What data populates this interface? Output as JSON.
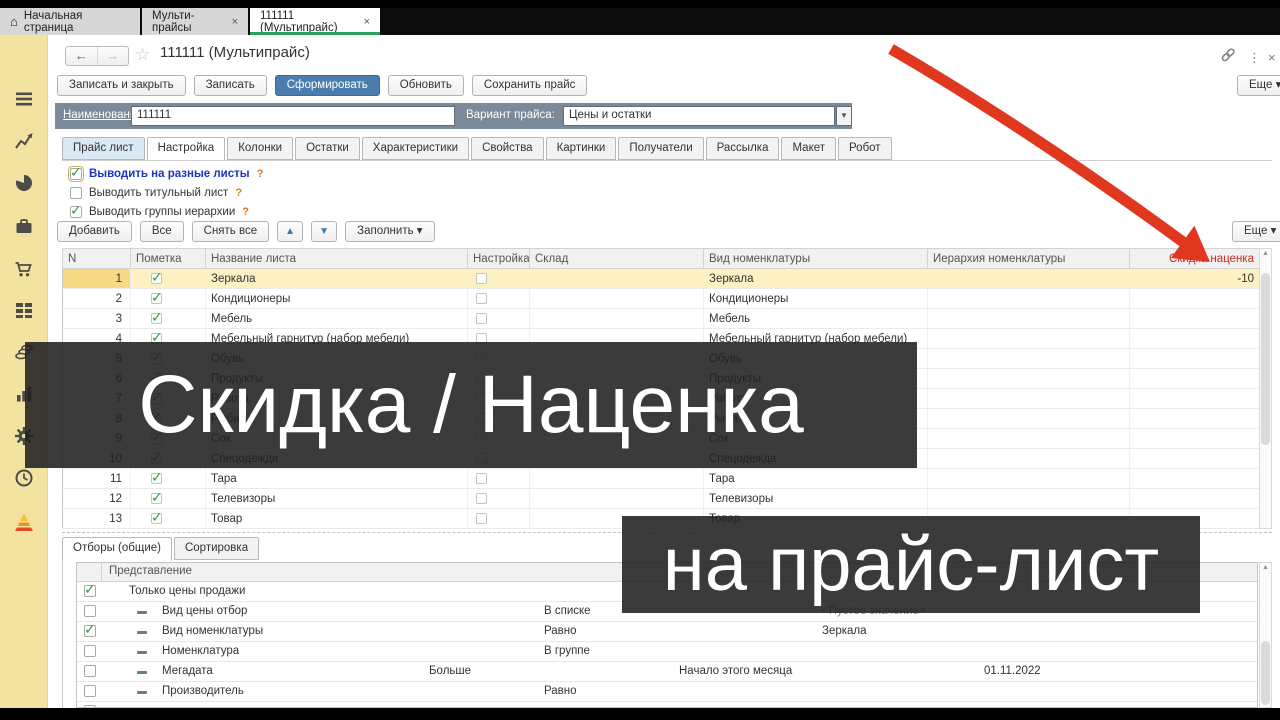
{
  "window_tabs": [
    {
      "label": "Начальная страница",
      "close": "",
      "active": false
    },
    {
      "label": "Мульти-прайсы",
      "close": "×",
      "active": false
    },
    {
      "label": "111111 (Мультипрайс)",
      "close": "×",
      "active": true
    }
  ],
  "titlebar": {
    "back": "←",
    "forward": "→",
    "star": "☆",
    "title": "111111 (Мультипрайс)",
    "dots": "⋮",
    "close": "×",
    "more": "Еще ▾"
  },
  "commandbar": {
    "buttons": [
      "Записать и закрыть",
      "Записать",
      "Сформировать",
      "Обновить",
      "Сохранить прайс"
    ],
    "primary_index": 2
  },
  "fieldbar": {
    "name_label": "Наименование:",
    "name_value": "111111",
    "variant_label": "Вариант прайса:",
    "variant_value": "Цены и остатки",
    "dropdown_arrow": "▼"
  },
  "page_tabs": [
    "Прайс лист",
    "Настройка",
    "Колонки",
    "Остатки",
    "Характеристики",
    "Свойства",
    "Картинки",
    "Получатели",
    "Рассылка",
    "Макет",
    "Робот"
  ],
  "active_page_tab": "Настройка",
  "options": [
    {
      "label": "Выводить на разные листы",
      "help": "?",
      "checked": true,
      "focused": true
    },
    {
      "label": "Выводить титульный лист",
      "help": "?",
      "checked": false,
      "focused": false
    },
    {
      "label": "Выводить группы иерархии",
      "help": "?",
      "checked": true,
      "focused": false
    }
  ],
  "grid_toolbar": {
    "add": "Добавить",
    "all": "Все",
    "clear": "Снять все",
    "up": "▲",
    "down": "▼",
    "fill": "Заполнить ▾",
    "more": "Еще ▾"
  },
  "sheets_table": {
    "columns": [
      "N",
      "Пометка",
      "Название листа",
      "Настройка",
      "Склад",
      "Вид номенклатуры",
      "Иерархия номенклатуры",
      "Скидка наценка"
    ],
    "scroll_up": "▲",
    "rows": [
      {
        "n": "1",
        "marked": true,
        "name": "Зеркала",
        "config": false,
        "warehouse": "",
        "nom_type": "Зеркала",
        "hierarchy": "",
        "discount": "-10",
        "selected": true
      },
      {
        "n": "2",
        "marked": true,
        "name": "Кондиционеры",
        "config": false,
        "warehouse": "",
        "nom_type": "Кондиционеры",
        "hierarchy": "",
        "discount": "",
        "selected": false
      },
      {
        "n": "3",
        "marked": true,
        "name": "Мебель",
        "config": false,
        "warehouse": "",
        "nom_type": "Мебель",
        "hierarchy": "",
        "discount": "",
        "selected": false
      },
      {
        "n": "4",
        "marked": true,
        "name": "Мебельный гарнитур (набор мебели)",
        "config": false,
        "warehouse": "",
        "nom_type": "Мебельный гарнитур (набор мебели)",
        "hierarchy": "",
        "discount": "",
        "selected": false
      },
      {
        "n": "5",
        "marked": true,
        "name": "Обувь",
        "config": false,
        "warehouse": "",
        "nom_type": "Обувь",
        "hierarchy": "",
        "discount": "",
        "selected": false
      },
      {
        "n": "6",
        "marked": true,
        "name": "Продукты",
        "config": false,
        "warehouse": "",
        "nom_type": "Продукты",
        "hierarchy": "",
        "discount": "",
        "selected": false
      },
      {
        "n": "7",
        "marked": true,
        "name": "Работа",
        "config": false,
        "warehouse": "",
        "nom_type": "Работа",
        "hierarchy": "",
        "discount": "",
        "selected": false
      },
      {
        "n": "8",
        "marked": true,
        "name": "Рыба",
        "config": false,
        "warehouse": "",
        "nom_type": "Рыба",
        "hierarchy": "",
        "discount": "",
        "selected": false
      },
      {
        "n": "9",
        "marked": true,
        "name": "Сок",
        "config": false,
        "warehouse": "",
        "nom_type": "Сок",
        "hierarchy": "",
        "discount": "",
        "selected": false
      },
      {
        "n": "10",
        "marked": true,
        "name": "Спецодежда",
        "config": false,
        "warehouse": "",
        "nom_type": "Спецодежда",
        "hierarchy": "",
        "discount": "",
        "selected": false
      },
      {
        "n": "11",
        "marked": true,
        "name": "Тара",
        "config": false,
        "warehouse": "",
        "nom_type": "Тара",
        "hierarchy": "",
        "discount": "",
        "selected": false
      },
      {
        "n": "12",
        "marked": true,
        "name": "Телевизоры",
        "config": false,
        "warehouse": "",
        "nom_type": "Телевизоры",
        "hierarchy": "",
        "discount": "",
        "selected": false
      },
      {
        "n": "13",
        "marked": true,
        "name": "Товар",
        "config": false,
        "warehouse": "",
        "nom_type": "Товар",
        "hierarchy": "",
        "discount": "",
        "selected": false
      }
    ]
  },
  "filter_section": {
    "tabs": [
      {
        "label": "Отборы (общие)",
        "active": true
      },
      {
        "label": "Сортировка",
        "active": false
      }
    ],
    "header": "Представление",
    "scroll_up": "▲",
    "rows": [
      {
        "checked": true,
        "dash": false,
        "label": "Только цены продажи",
        "op_near": "",
        "op": "",
        "value_left": "",
        "value_mid": "",
        "value_right": ""
      },
      {
        "checked": false,
        "dash": true,
        "label": "Вид цены отбор",
        "op_near": "",
        "op": "В списке",
        "value_left": "",
        "value_mid": "<Пустое значение>",
        "value_right": ""
      },
      {
        "checked": true,
        "dash": true,
        "label": "Вид номенклатуры",
        "op_near": "",
        "op": "Равно",
        "value_left": "",
        "value_mid": "Зеркала",
        "value_right": ""
      },
      {
        "checked": false,
        "dash": true,
        "label": "Номенклатура",
        "op_near": "",
        "op": "В группе",
        "value_left": "",
        "value_mid": "",
        "value_right": ""
      },
      {
        "checked": false,
        "dash": true,
        "label": "Мегадата",
        "op_near": "Больше",
        "op": "",
        "value_left": "Начало этого месяца",
        "value_mid": "",
        "value_right": "01.11.2022"
      },
      {
        "checked": false,
        "dash": true,
        "label": "Производитель",
        "op_near": "",
        "op": "Равно",
        "value_left": "",
        "value_mid": "",
        "value_right": ""
      }
    ]
  },
  "overlay_captions": {
    "line1": "Скидка / Наценка",
    "line2": "на прайс-лист"
  },
  "sidebar_icons": [
    "menu",
    "analytics",
    "reports-pie",
    "briefcase",
    "shopping-cart",
    "catalog-grid",
    "money-coins",
    "bar-chart",
    "settings-gear",
    "history-clock",
    "pyramid-logo"
  ],
  "colors": {
    "accent_blue": "#4a7dae",
    "sidebar_yellow": "#f3e3a1",
    "selected_row": "#fdf0c2",
    "discount_header_red": "#cc2a1f",
    "arrow_red": "#e0371f",
    "tab_underline_green": "#2aa05a",
    "check_green": "#2f9e44"
  }
}
